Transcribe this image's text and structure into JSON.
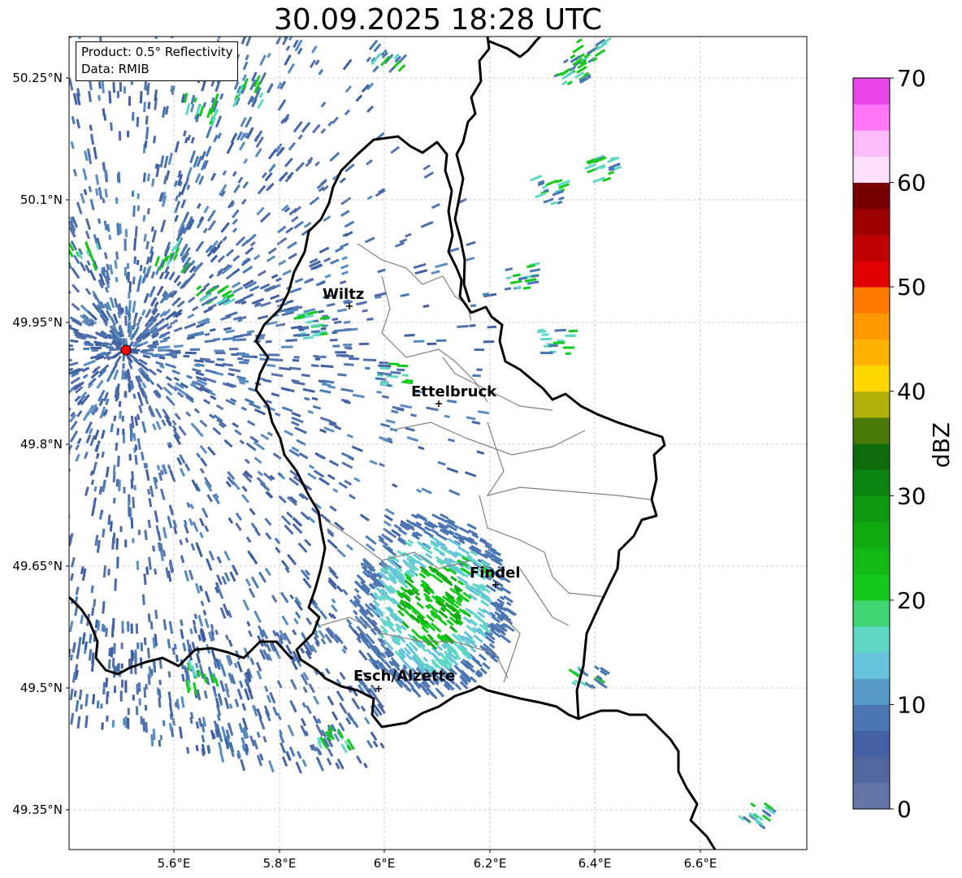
{
  "title": "30.09.2025 18:28 UTC",
  "info": {
    "product": "Product: 0.5° Reflectivity",
    "data": "Data: RMIB"
  },
  "axes": {
    "lon_ticks": [
      "5.6°E",
      "5.8°E",
      "6°E",
      "6.2°E",
      "6.4°E",
      "6.6°E"
    ],
    "lat_ticks": [
      "50.25°N",
      "50.1°N",
      "49.95°N",
      "49.8°N",
      "49.65°N",
      "49.5°N",
      "49.35°N"
    ],
    "gridlines": true
  },
  "cities": [
    {
      "name": "Wiltz"
    },
    {
      "name": "Ettelbruck"
    },
    {
      "name": "Findel"
    },
    {
      "name": "Esch/Alzette"
    }
  ],
  "colorbar": {
    "label": "dBZ",
    "ticks": [
      "0",
      "10",
      "20",
      "30",
      "40",
      "50",
      "60",
      "70"
    ],
    "range": [
      0,
      70
    ],
    "step": 2.5,
    "colors": [
      "#6476a8",
      "#53679f",
      "#4560a6",
      "#4b76b2",
      "#5599c6",
      "#67c2dc",
      "#5fd7c5",
      "#3fd572",
      "#14c91b",
      "#14b916",
      "#12a913",
      "#0f9911",
      "#0d840f",
      "#0c6c0c",
      "#4a7b0a",
      "#b1b107",
      "#ffd700",
      "#ffb300",
      "#ff9900",
      "#ff7b00",
      "#e00000",
      "#c00000",
      "#9e0000",
      "#770000",
      "#ffe0fc",
      "#ffbbfb",
      "#ff77f8",
      "#e945e9"
    ]
  },
  "colors": {
    "radar_main": "#4b68a8",
    "radar_light": "#5fc6d6",
    "radar_green": "#14c91b",
    "border": "#000000",
    "district": "#808080",
    "radar_site": "#ff0000"
  }
}
